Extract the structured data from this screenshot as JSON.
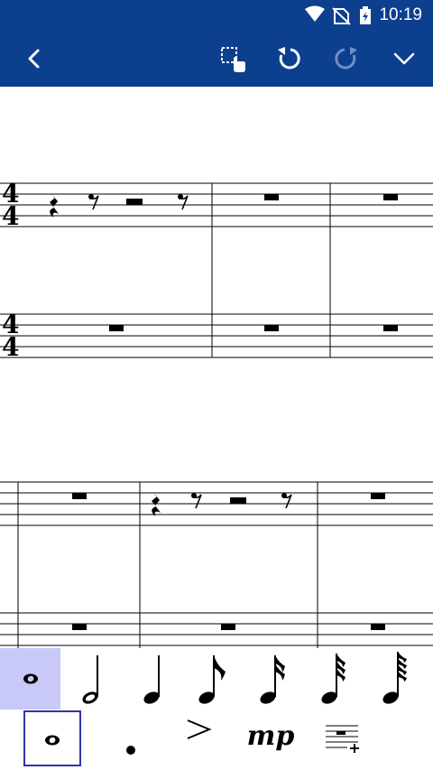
{
  "status_bar": {
    "time": "10:19"
  },
  "toolbar": {
    "back_icon": "chevron-left-icon",
    "select_icon": "select-region-icon",
    "undo_icon": "undo-icon",
    "redo_icon": "redo-icon",
    "collapse_icon": "chevron-down-icon"
  },
  "score": {
    "time_signature": {
      "numerator": "4",
      "denominator": "4"
    },
    "systems": [
      {
        "measures": [
          {
            "top": "quarter rest, eighth rest, half rest, eighth rest",
            "bottom": "whole rest"
          },
          {
            "top": "whole rest",
            "bottom": "whole rest"
          },
          {
            "top": "whole rest",
            "bottom": "whole rest"
          }
        ]
      },
      {
        "measures": [
          {
            "top": "whole rest",
            "bottom": "whole rest"
          },
          {
            "top": "quarter rest, eighth rest, half rest, eighth rest",
            "bottom": "whole rest"
          },
          {
            "top": "whole rest",
            "bottom": "whole rest"
          }
        ]
      }
    ]
  },
  "palette": {
    "durations": [
      "whole",
      "half",
      "quarter",
      "eighth",
      "16th",
      "32nd",
      "64th"
    ],
    "selected_duration": "whole",
    "tools": [
      "whole-note",
      "dot",
      "accent",
      "mp",
      "add-measure"
    ],
    "dynamic_label": "mp",
    "accent_glyph": ">",
    "colors": {
      "selected_bg": "#c9c9f7",
      "selected_border": "#3333aa",
      "toolbar": "#0d3f8f"
    }
  }
}
